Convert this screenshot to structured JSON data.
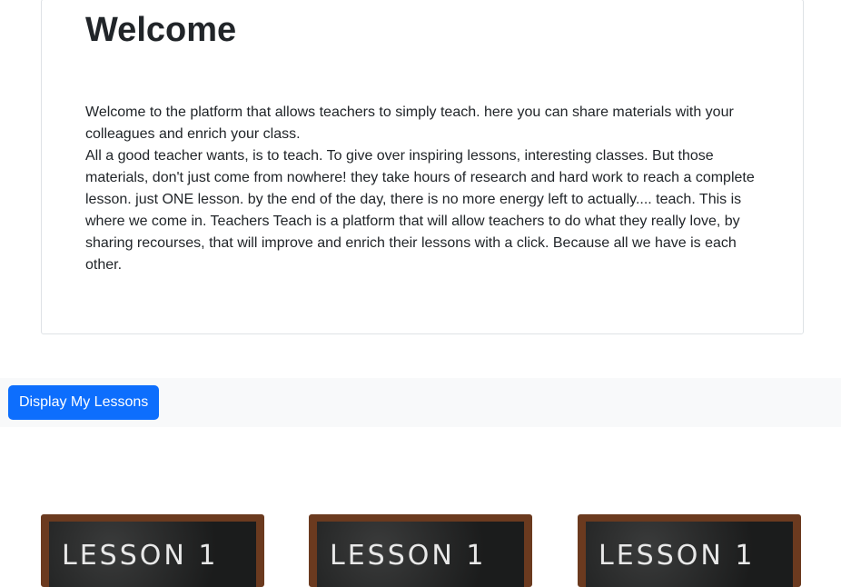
{
  "welcome": {
    "title": "Welcome",
    "paragraph_1": "Welcome to the platform that allows teachers to simply teach. here you can share materials with your colleagues and enrich your class.",
    "paragraph_2": "All a good teacher wants, is to teach. To give over inspiring lessons, interesting classes. But those materials, don't just come from nowhere! they take hours of research and hard work to reach a complete lesson. just ONE lesson. by the end of the day, there is no more energy left to actually.... teach. This is where we come in. Teachers Teach is a platform that will allow teachers to do what they really love, by sharing recourses, that will improve and enrich their lessons with a click. Because all we have is each other."
  },
  "toolbar": {
    "display_button_label": "Display My Lessons"
  },
  "lessons": [
    {
      "image_text": "LESSON 1"
    },
    {
      "image_text": "LESSON 1"
    },
    {
      "image_text": "LESSON 1"
    }
  ],
  "colors": {
    "primary": "#0d6efd",
    "toolbar_bg": "#f8f9fa",
    "chalkboard_frame": "#6b3a1f",
    "chalkboard": "#1e1f1f"
  }
}
